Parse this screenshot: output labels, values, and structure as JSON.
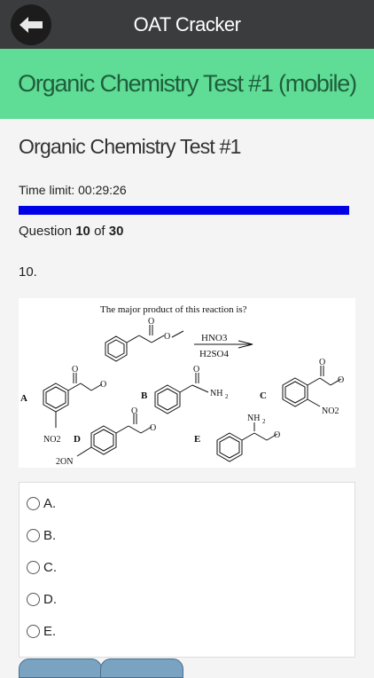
{
  "app": {
    "title": "OAT Cracker"
  },
  "banner": {
    "title": "Organic Chemistry Test #1 (mobile)"
  },
  "test": {
    "title": "Organic Chemistry Test #1",
    "time_limit": "Time limit: 00:29:26",
    "progress": 1.0,
    "question_word": "Question",
    "question_current": "10",
    "question_of": "of",
    "question_total": "30",
    "question_number": "10."
  },
  "figure": {
    "prompt": "The major product of this reaction is?",
    "reagent_top": "HNO3",
    "reagent_bottom": "H2SO4",
    "labels": {
      "a": "A",
      "b": "B",
      "c": "C",
      "d": "D",
      "e": "E"
    },
    "groups": {
      "no2": "NO2",
      "nh2": "NH2",
      "o2n": "2ON"
    }
  },
  "options": [
    {
      "label": "A."
    },
    {
      "label": "B."
    },
    {
      "label": "C."
    },
    {
      "label": "D."
    },
    {
      "label": "E."
    }
  ],
  "colors": {
    "header": "#3b3c3e",
    "banner": "#5fdc96",
    "progress": "#0000e6"
  }
}
